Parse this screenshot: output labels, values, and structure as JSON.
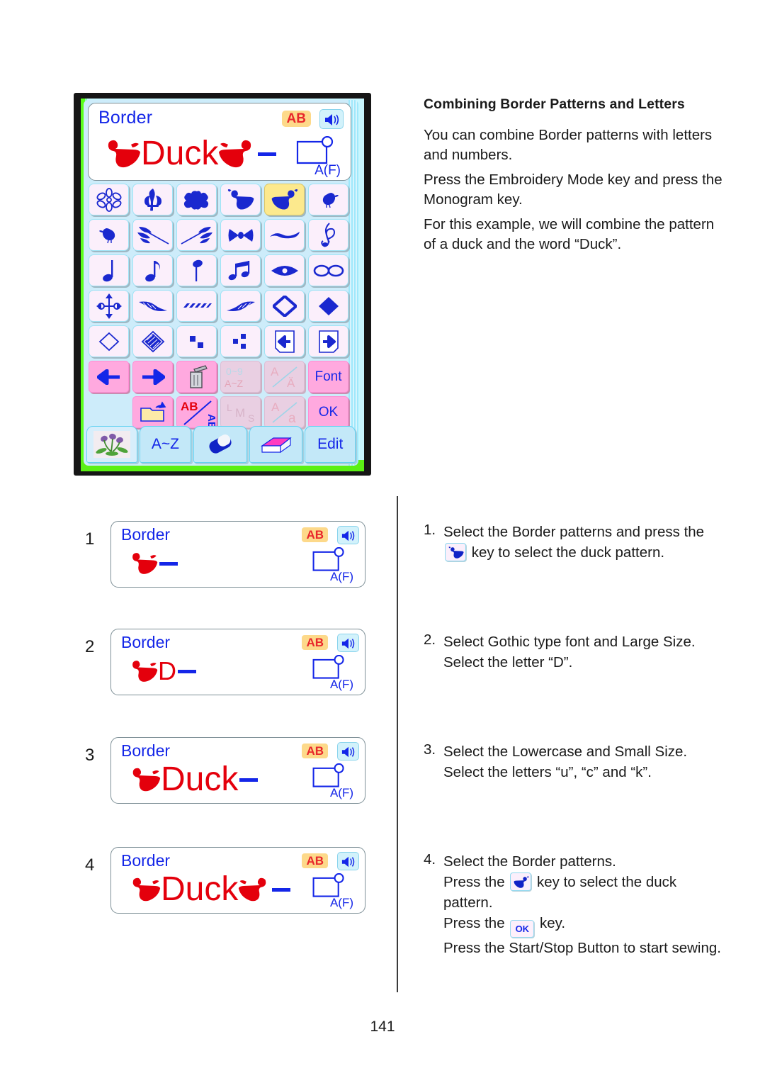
{
  "document": {
    "page_number": "141",
    "section_title": "Combining Border Patterns and Letters",
    "paragraphs": [
      "You can combine Border patterns with letters and numbers.",
      "Press the Embroidery Mode key and press the Monogram key.",
      "For this example, we will combine the pattern of a duck and the word “Duck”."
    ]
  },
  "lcd": {
    "title": "Border",
    "badge_ab": "AB",
    "speaker_icon": "speaker-icon",
    "hoop_icon": "hoop-icon",
    "hoop_label": "A(F)",
    "display_text": "Duck",
    "cursor": "_",
    "colors": {
      "title_blue": "#1426e8",
      "text_red": "#e4000c",
      "badge_bg": "#fdd98a",
      "badge_fg": "#e8262b",
      "screen_bg": "#cdecfa",
      "key_bg": "#fbeffb",
      "key_selected_bg": "#fce98d",
      "function_key_bg": "#ffa9df",
      "bezel": "#161616",
      "green_edge": "#5bf014"
    },
    "pattern_keys": [
      [
        {
          "name": "flower-daisy-outline-icon",
          "selected": false
        },
        {
          "name": "fleur-de-lis-icon",
          "selected": false
        },
        {
          "name": "clover-leaf-icon",
          "selected": false
        },
        {
          "name": "duck-left-icon",
          "selected": false
        },
        {
          "name": "duck-right-icon",
          "selected": true
        },
        {
          "name": "chick-right-icon",
          "selected": false
        }
      ],
      [
        {
          "name": "chick-left-icon",
          "selected": false
        },
        {
          "name": "wheat-sprig-left-icon",
          "selected": false
        },
        {
          "name": "wheat-sprig-right-icon",
          "selected": false
        },
        {
          "name": "bow-icon",
          "selected": false
        },
        {
          "name": "ribbon-wave-icon",
          "selected": false
        },
        {
          "name": "treble-clef-icon",
          "selected": false
        }
      ],
      [
        {
          "name": "quarter-note-icon",
          "selected": false
        },
        {
          "name": "eighth-note-icon",
          "selected": false
        },
        {
          "name": "half-note-icon",
          "selected": false
        },
        {
          "name": "beamed-notes-icon",
          "selected": false
        },
        {
          "name": "eyelet-icon",
          "selected": false
        },
        {
          "name": "infinity-loops-icon",
          "selected": false
        }
      ],
      [
        {
          "name": "four-direction-arrows-icon",
          "selected": false
        },
        {
          "name": "feather-left-icon",
          "selected": false
        },
        {
          "name": "dashes-row-icon",
          "selected": false
        },
        {
          "name": "feather-right-icon",
          "selected": false
        },
        {
          "name": "diamond-outline-thick-icon",
          "selected": false
        },
        {
          "name": "diamond-filled-icon",
          "selected": false
        }
      ],
      [
        {
          "name": "diamond-thin-outline-icon",
          "selected": false
        },
        {
          "name": "diamond-hatched-icon",
          "selected": false
        },
        {
          "name": "two-squares-icon",
          "selected": false
        },
        {
          "name": "three-squares-icon",
          "selected": false
        },
        {
          "name": "page-left-icon",
          "selected": false
        },
        {
          "name": "page-right-icon",
          "selected": false
        }
      ]
    ],
    "function_row_1": [
      {
        "name": "cursor-left-button",
        "label": "",
        "icon": "arrow-left-icon",
        "enabled": true
      },
      {
        "name": "cursor-right-button",
        "label": "",
        "icon": "arrow-right-icon",
        "enabled": true
      },
      {
        "name": "delete-button",
        "label": "",
        "icon": "trash-icon",
        "enabled": true
      },
      {
        "name": "numbers-letters-toggle-button",
        "label": "0~9 / A~Z",
        "icon": "num-alpha-icon",
        "enabled": false
      },
      {
        "name": "accent-toggle-button",
        "label": "A / Ä",
        "icon": "accent-icon",
        "enabled": false
      },
      {
        "name": "font-button",
        "label": "Font",
        "icon": "",
        "enabled": true
      }
    ],
    "function_row_2": [
      {
        "name": "spacer",
        "label": "",
        "icon": "",
        "enabled": true
      },
      {
        "name": "memory-recall-button",
        "label": "",
        "icon": "folder-arrow-icon",
        "enabled": true
      },
      {
        "name": "letter-orientation-button",
        "label": "AB / AB",
        "icon": "ab-rotate-icon",
        "enabled": true
      },
      {
        "name": "size-button",
        "label": "L M S",
        "icon": "size-icon",
        "enabled": false
      },
      {
        "name": "case-button",
        "label": "A / a",
        "icon": "case-icon",
        "enabled": false
      },
      {
        "name": "ok-button",
        "label": "OK",
        "icon": "",
        "enabled": true
      }
    ],
    "tabs": [
      {
        "name": "tab-embroidery-designs",
        "label": "",
        "icon": "flower-photo-icon"
      },
      {
        "name": "tab-monogram",
        "label": "A~Z",
        "icon": ""
      },
      {
        "name": "tab-eraser",
        "label": "",
        "icon": "eraser-icon"
      },
      {
        "name": "tab-book",
        "label": "",
        "icon": "book-icon"
      },
      {
        "name": "tab-edit",
        "label": "Edit",
        "icon": ""
      }
    ]
  },
  "step_screens": [
    {
      "number": "1",
      "title": "Border",
      "badge_ab": "AB",
      "hoop_label": "A(F)",
      "text": "",
      "ducks_before": 1,
      "ducks_after": 0,
      "cursor": "_"
    },
    {
      "number": "2",
      "title": "Border",
      "badge_ab": "AB",
      "hoop_label": "A(F)",
      "text": "D",
      "ducks_before": 1,
      "ducks_after": 0,
      "cursor": "_"
    },
    {
      "number": "3",
      "title": "Border",
      "badge_ab": "AB",
      "hoop_label": "A(F)",
      "text": "Duck",
      "ducks_before": 1,
      "ducks_after": 0,
      "cursor": "_"
    },
    {
      "number": "4",
      "title": "Border",
      "badge_ab": "AB",
      "hoop_label": "A(F)",
      "text": "Duck",
      "ducks_before": 1,
      "ducks_after": 1,
      "cursor": "_"
    }
  ],
  "steps": [
    {
      "number": "1.",
      "line1_a": "Select the Border patterns and press the",
      "line2_a": "",
      "line2_b": "key to select the duck pattern.",
      "chip": "duck-left-icon"
    },
    {
      "number": "2.",
      "line1_a": "Select Gothic type font and Large Size.",
      "line2_a": "Select the letter “D”.",
      "line2_b": "",
      "chip": ""
    },
    {
      "number": "3.",
      "line1_a": "Select the Lowercase and Small Size.",
      "line2_a": "Select the letters “u”, “c” and “k”.",
      "line2_b": "",
      "chip": ""
    },
    {
      "number": "4.",
      "line1_a": "Select the Border patterns.",
      "line2_a": "Press the",
      "line2_b": "key to select the duck",
      "line3_a": "pattern.",
      "line4_a": "Press the",
      "line4_b": "key.",
      "line5_a": "Press the Start/Stop Button to start sewing.",
      "ok_label": "OK",
      "chip": "duck-right-icon"
    }
  ]
}
